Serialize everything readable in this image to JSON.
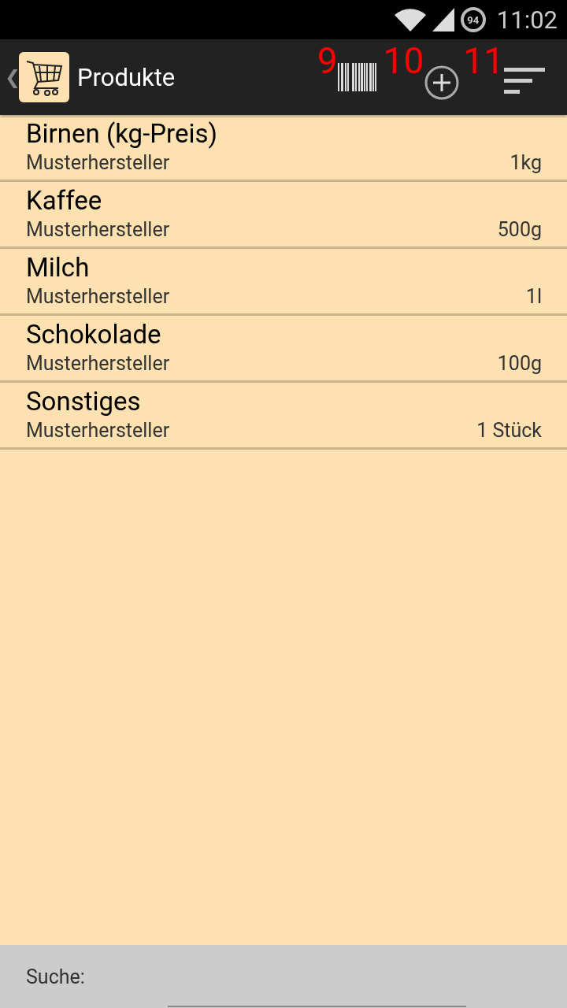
{
  "status_bar": {
    "battery": "94",
    "time": "11:02"
  },
  "action_bar": {
    "back": "❮",
    "title": "Produkte",
    "markers": [
      "9",
      "10",
      "11"
    ]
  },
  "products": [
    {
      "name": "Birnen (kg-Preis)",
      "maker": "Musterhersteller",
      "unit": "1kg"
    },
    {
      "name": "Kaffee",
      "maker": "Musterhersteller",
      "unit": "500g"
    },
    {
      "name": "Milch",
      "maker": "Musterhersteller",
      "unit": "1l"
    },
    {
      "name": "Schokolade",
      "maker": "Musterhersteller",
      "unit": "100g"
    },
    {
      "name": "Sonstiges",
      "maker": "Musterhersteller",
      "unit": "1 Stück"
    }
  ],
  "search": {
    "label": "Suche:"
  }
}
